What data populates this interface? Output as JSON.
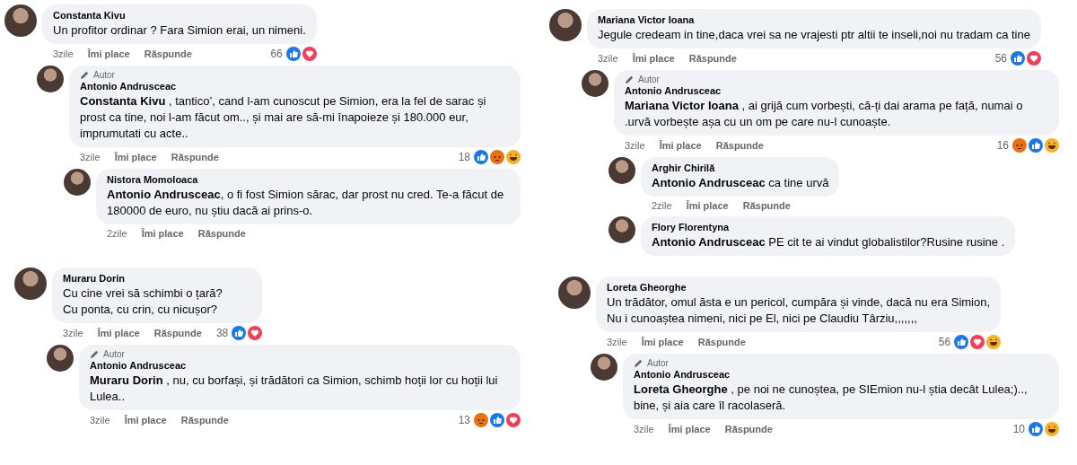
{
  "panels": [
    {
      "comments": [
        {
          "author": "Constanta Kivu",
          "text": "Un profitor ordinar ? Fara Simion erai, un nimeni.",
          "time": "3zile",
          "like": "Îmi place",
          "reply": "Răspunde",
          "count": "66",
          "reactions": [
            {
              "kind": "like"
            },
            {
              "kind": "love"
            }
          ],
          "children": [
            {
              "author": "Antonio Andrusceac",
              "badge": "Autor",
              "text": "**Constanta Kivu** , tantico’, cand l-am cunoscut pe Simion, era la fel de sarac și prost ca tine, noi l-am făcut om.., și mai are să-mi înapoieze și 180.000 eur, imprumutati cu acte..",
              "time": "3zile",
              "like": "Îmi place",
              "reply": "Răspunde",
              "count": "18",
              "reactions": [
                {
                  "kind": "like"
                },
                {
                  "kind": "angry"
                },
                {
                  "kind": "haha"
                }
              ],
              "children": [
                {
                  "author": "Nistora Momoloaca",
                  "text": "**Antonio Andrusceac**, o fi fost Simion sărac, dar prost nu cred. Te-a făcut de 180000 de euro, nu știu dacă ai prins-o.",
                  "time": "2zile",
                  "like": "Îmi place",
                  "reply": "Răspunde"
                }
              ]
            }
          ]
        }
      ]
    },
    {
      "comments": [
        {
          "author": "Mariana Victor Ioana",
          "text": "Jegule credeam in tine,daca vrei sa ne vrajesti ptr altii te inseli,noi nu tradam ca tine",
          "time": "3zile",
          "like": "Îmi place",
          "reply": "Răspunde",
          "count": "56",
          "reactions": [
            {
              "kind": "like"
            },
            {
              "kind": "love"
            }
          ],
          "children": [
            {
              "author": "Antonio Andrusceac",
              "badge": "Autor",
              "text": "**Mariana Victor Ioana** , ai grijă cum vorbești, că-ți dai arama pe față, numai o .urvă vorbește așa cu un om pe care nu-l cunoaște.",
              "time": "3zile",
              "like": "Îmi place",
              "reply": "Răspunde",
              "count": "16",
              "reactions": [
                {
                  "kind": "angry"
                },
                {
                  "kind": "like"
                },
                {
                  "kind": "haha"
                }
              ],
              "children": [
                {
                  "author": "Arghir Chirilă",
                  "text": "**Antonio Andrusceac** ca tine urvă",
                  "time": "2zile",
                  "like": "Îmi place",
                  "reply": "Răspunde"
                },
                {
                  "author": "Flory Florentyna",
                  "text": "**Antonio Andrusceac** PE cit te ai vindut globalistilor?Rusine rusine ."
                }
              ]
            }
          ]
        }
      ]
    },
    {
      "comments": [
        {
          "author": "Muraru Dorin",
          "text": "Cu cine vrei să schimbi o țară?\nCu ponta, cu crin, cu nicușor?",
          "time": "3zile",
          "like": "Îmi place",
          "reply": "Răspunde",
          "count": "38",
          "reactions": [
            {
              "kind": "like"
            },
            {
              "kind": "love"
            }
          ],
          "children": [
            {
              "author": "Antonio Andrusceac",
              "badge": "Autor",
              "text": "**Muraru Dorin** , nu, cu borfași, și trădători ca Simion, schimb hoții lor cu hoții lui Lulea..",
              "time": "3zile",
              "like": "Îmi place",
              "reply": "Răspunde",
              "count": "13",
              "reactions": [
                {
                  "kind": "angry"
                },
                {
                  "kind": "like"
                },
                {
                  "kind": "love"
                }
              ]
            }
          ]
        }
      ]
    },
    {
      "comments": [
        {
          "author": "Loreta Gheorghe",
          "text": "Un trădător, omul ăsta e un pericol, cumpăra și vinde, dacă nu era Simion,\nNu i cunoaștea nimeni, nici pe El, nici pe Claudiu Târziu,,,,,,,",
          "time": "3zile",
          "like": "Îmi place",
          "reply": "Răspunde",
          "count": "56",
          "reactions": [
            {
              "kind": "like"
            },
            {
              "kind": "love"
            },
            {
              "kind": "haha"
            }
          ],
          "children": [
            {
              "author": "Antonio Andrusceac",
              "badge": "Autor",
              "text": "**Loreta Gheorghe** , pe noi ne cunoștea, pe SIEmion nu-l știa decât Lulea;).., bine, și aia care îl racolaseră.",
              "time": "3zile",
              "like": "Îmi place",
              "reply": "Răspunde",
              "count": "10",
              "reactions": [
                {
                  "kind": "like"
                },
                {
                  "kind": "haha"
                }
              ]
            }
          ]
        }
      ]
    }
  ]
}
